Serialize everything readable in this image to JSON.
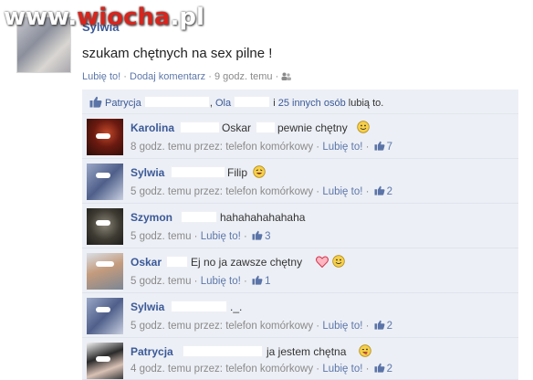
{
  "watermark": {
    "prefix": "www.",
    "brand": "wiocha",
    "suffix": ".pl"
  },
  "post": {
    "author": "Sylwia",
    "text": "szukam chętnych na sex pilne !",
    "like_label": "Lubię to!",
    "comment_label": "Dodaj komentarz",
    "time": "9 godz. temu",
    "separator": "·"
  },
  "likes": {
    "name1": "Patrycja",
    "name2": "Ola",
    "and": "i",
    "others": "25 innych osób",
    "suffix": "lubią to."
  },
  "comments": [
    {
      "name": "Karolina",
      "mention": "Oskar",
      "text": "pewnie chętny",
      "emoji": "smile",
      "time": "8 godz. temu przez: telefon komórkowy",
      "like_label": "Lubię to!",
      "likes": "7"
    },
    {
      "name": "Sylwia",
      "mention": "Filip",
      "text": "",
      "emoji": "grin",
      "time": "5 godz. temu przez: telefon komórkowy",
      "like_label": "Lubię to!",
      "likes": "2"
    },
    {
      "name": "Szymon",
      "mention": "",
      "text": "hahahahahahaha",
      "emoji": "",
      "time": "5 godz. temu",
      "like_label": "Lubię to!",
      "likes": "3"
    },
    {
      "name": "Oskar",
      "mention": "",
      "text": "Ej no ja zawsze chętny",
      "emoji": "heart-smile",
      "time": "5 godz. temu",
      "like_label": "Lubię to!",
      "likes": "1"
    },
    {
      "name": "Sylwia",
      "mention": "",
      "text": "._.",
      "emoji": "",
      "time": "5 godz. temu przez: telefon komórkowy",
      "like_label": "Lubię to!",
      "likes": "2"
    },
    {
      "name": "Patrycja",
      "mention": "",
      "text": "ja jestem chętna",
      "emoji": "wink",
      "time": "4 godz. temu przez: telefon komórkowy",
      "like_label": "Lubię to!",
      "likes": "2"
    }
  ],
  "colors": {
    "link": "#3b5998",
    "meta": "#8a8a8a",
    "comment_bg": "#eceff5",
    "watermark_red": "#d7251d"
  },
  "icons": {
    "like": "thumbs-up-icon",
    "audience": "friends-icon",
    "emoji": "smiley-icon"
  }
}
